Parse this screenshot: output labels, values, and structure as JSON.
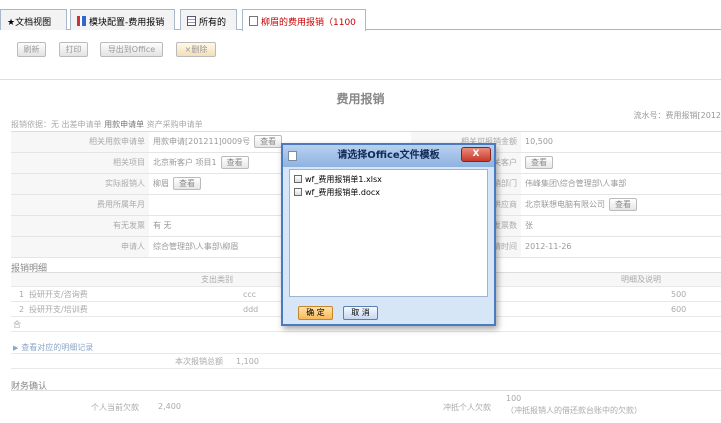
{
  "tabs": [
    {
      "label": "★文档视图"
    },
    {
      "label": "模块配置-费用报销"
    },
    {
      "label": "所有的"
    },
    {
      "label": "柳眉的费用报销（1100"
    }
  ],
  "toolbar": {
    "refresh": "刷新",
    "print": "打印",
    "export": "导出到Office",
    "delete": "×删除"
  },
  "form": {
    "title": "费用报销",
    "serial": "流水号：费用报销[2012",
    "basis_label": "报销依据：",
    "basis_opt1": "无  出差申请单",
    "basis_opt2": "用款申请单",
    "basis_opt3": "资产采购申请单",
    "rows": [
      {
        "label": "相关用款申请单",
        "value": "用款申请[201211]0009号",
        "btn": "查看",
        "label2": "相关可报销金额",
        "value2": "10,500"
      },
      {
        "label": "相关项目",
        "value": "北京新客户 项目1",
        "btn": "查看",
        "label2": "相关客户",
        "value2": "",
        "btn2": "查看"
      },
      {
        "label": "实际报销人",
        "value": "柳眉",
        "btn": "查看",
        "label2": "报销部门",
        "value2": "伟峰集团\\综合管理部\\人事部"
      },
      {
        "label": "费用所属年月",
        "value": "",
        "label2": "相关供应商",
        "value2": "北京联想电脑有限公司",
        "btn2": "查看"
      },
      {
        "label": "有无发票",
        "value": "有  无",
        "label2": "发票数",
        "value2": "张"
      },
      {
        "label": "申请人",
        "value": "综合管理部\\人事部\\柳眉",
        "label2": "申请时间",
        "value2": "2012-11-26"
      }
    ]
  },
  "detail": {
    "section": "报销明细",
    "col_type": "支出类别",
    "col_note": "明细及说明",
    "rows": [
      {
        "idx": "1",
        "type": "投研开支/咨询费",
        "code": "ccc",
        "amount": "500"
      },
      {
        "idx": "2",
        "type": "投研开支/培训费",
        "code": "ddd",
        "amount": "600"
      }
    ],
    "total_mark": "合",
    "link": "查看对应的明细记录",
    "total_label": "本次报销总额",
    "total_value": "1,100"
  },
  "finance": {
    "section": "财务确认",
    "personal_label": "个人当前欠款",
    "personal_value": "2,400",
    "offset_label": "冲抵个人欠款",
    "offset_value": "100",
    "offset_note": "（冲抵报销人的借还款台账中的欠款）"
  },
  "dialog": {
    "title": "请选择Office文件模板",
    "close": "X",
    "files": [
      "wf_费用报销单1.xlsx",
      "wf_费用报销单.docx"
    ],
    "ok": "确 定",
    "cancel": "取 消"
  }
}
